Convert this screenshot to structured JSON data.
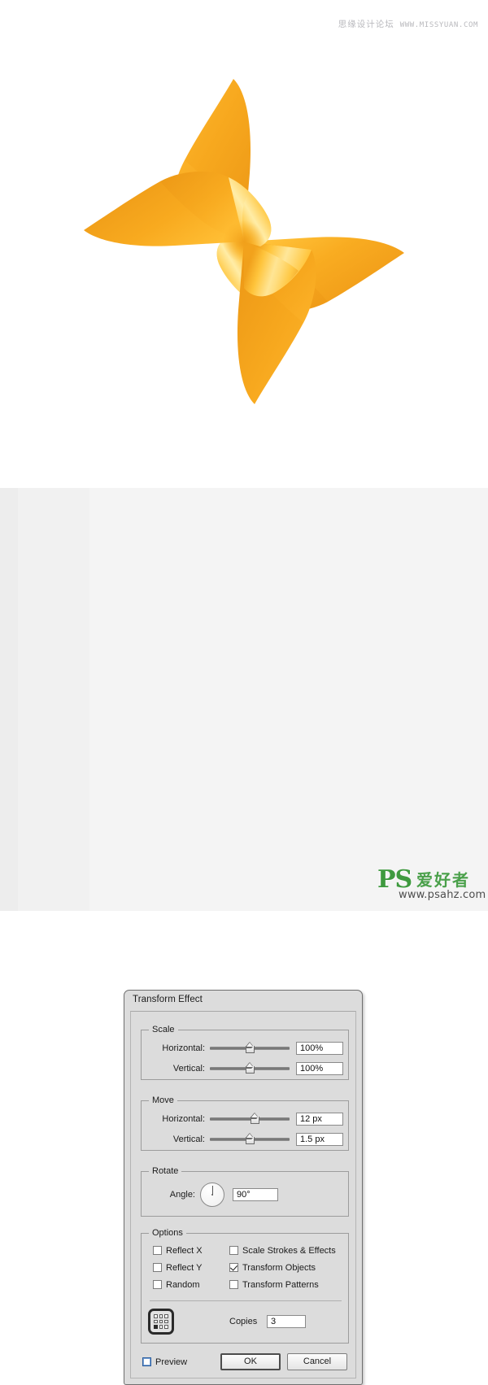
{
  "watermark": {
    "cn_text": "思缘设计论坛",
    "url_text": "WWW.MISSYUAN.COM"
  },
  "artwork": {
    "name": "pinwheel-illustration",
    "description": "Four-blade orange pinwheel",
    "colors": {
      "orange_base": "#F7A81E",
      "orange_dark": "#E8921A",
      "gold_light": "#FFD24A",
      "gold_highlight": "#FFE98F",
      "amber_mid": "#F9B227",
      "shadow": "#D98912"
    }
  },
  "dialog": {
    "title": "Transform Effect",
    "groups": {
      "scale": {
        "title": "Scale",
        "rows": [
          {
            "label": "Horizontal:",
            "value": "100%",
            "thumb_pct": 50
          },
          {
            "label": "Vertical:",
            "value": "100%",
            "thumb_pct": 50
          }
        ]
      },
      "move": {
        "title": "Move",
        "rows": [
          {
            "label": "Horizontal:",
            "value": "12 px",
            "thumb_pct": 55
          },
          {
            "label": "Vertical:",
            "value": "1.5 px",
            "thumb_pct": 50
          }
        ]
      },
      "rotate": {
        "title": "Rotate",
        "label": "Angle:",
        "value": "90°",
        "needle_deg": 0
      },
      "options": {
        "title": "Options",
        "left_column": [
          {
            "label": "Reflect X",
            "checked": false
          },
          {
            "label": "Reflect Y",
            "checked": false
          },
          {
            "label": "Random",
            "checked": false
          }
        ],
        "right_column": [
          {
            "label": "Scale Strokes & Effects",
            "checked": false
          },
          {
            "label": "Transform Objects",
            "checked": true
          },
          {
            "label": "Transform Patterns",
            "checked": false
          }
        ],
        "anchor": {
          "name": "reference-point-widget",
          "selected_index": 6,
          "selected_position": "bottom-left"
        },
        "copies": {
          "label": "Copies",
          "value": "3"
        }
      }
    },
    "footer": {
      "preview": {
        "label": "Preview",
        "checked": false
      },
      "ok_label": "OK",
      "cancel_label": "Cancel"
    }
  },
  "logo": {
    "ps_text": "PS",
    "cn_text": "爱好者",
    "site_text": "www.psahz.com",
    "color": "#4aa04a"
  }
}
